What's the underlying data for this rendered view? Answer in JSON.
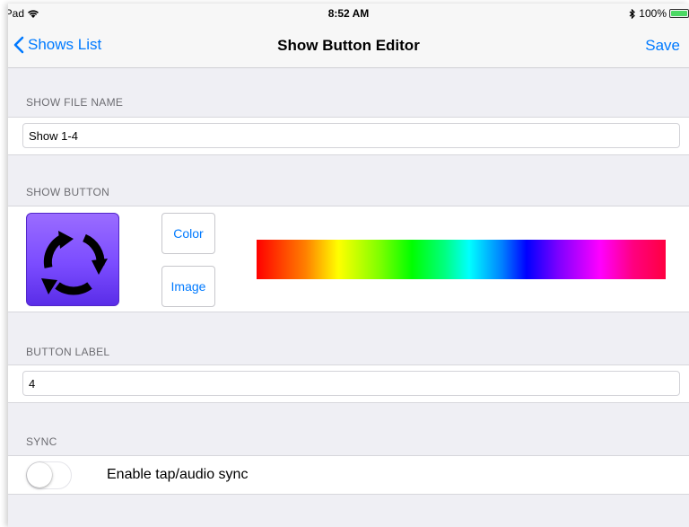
{
  "status_bar": {
    "device": "iPad",
    "time": "8:52 AM",
    "battery_percent": "100%",
    "battery_level": 1.0
  },
  "nav": {
    "back_label": "Shows List",
    "title": "Show Button Editor",
    "save_label": "Save"
  },
  "show_file": {
    "header": "SHOW FILE NAME",
    "value": "Show 1-4"
  },
  "show_button": {
    "header": "SHOW BUTTON",
    "color_label": "Color",
    "image_label": "Image",
    "swatch_icon": "circular-arrows-icon",
    "swatch_color": "#7b4cff"
  },
  "button_label": {
    "header": "BUTTON LABEL",
    "value": "4"
  },
  "sync": {
    "header": "SYNC",
    "toggle_label": "Enable tap/audio sync",
    "enabled": false
  },
  "colors": {
    "accent": "#007aff",
    "background": "#efeff4"
  }
}
